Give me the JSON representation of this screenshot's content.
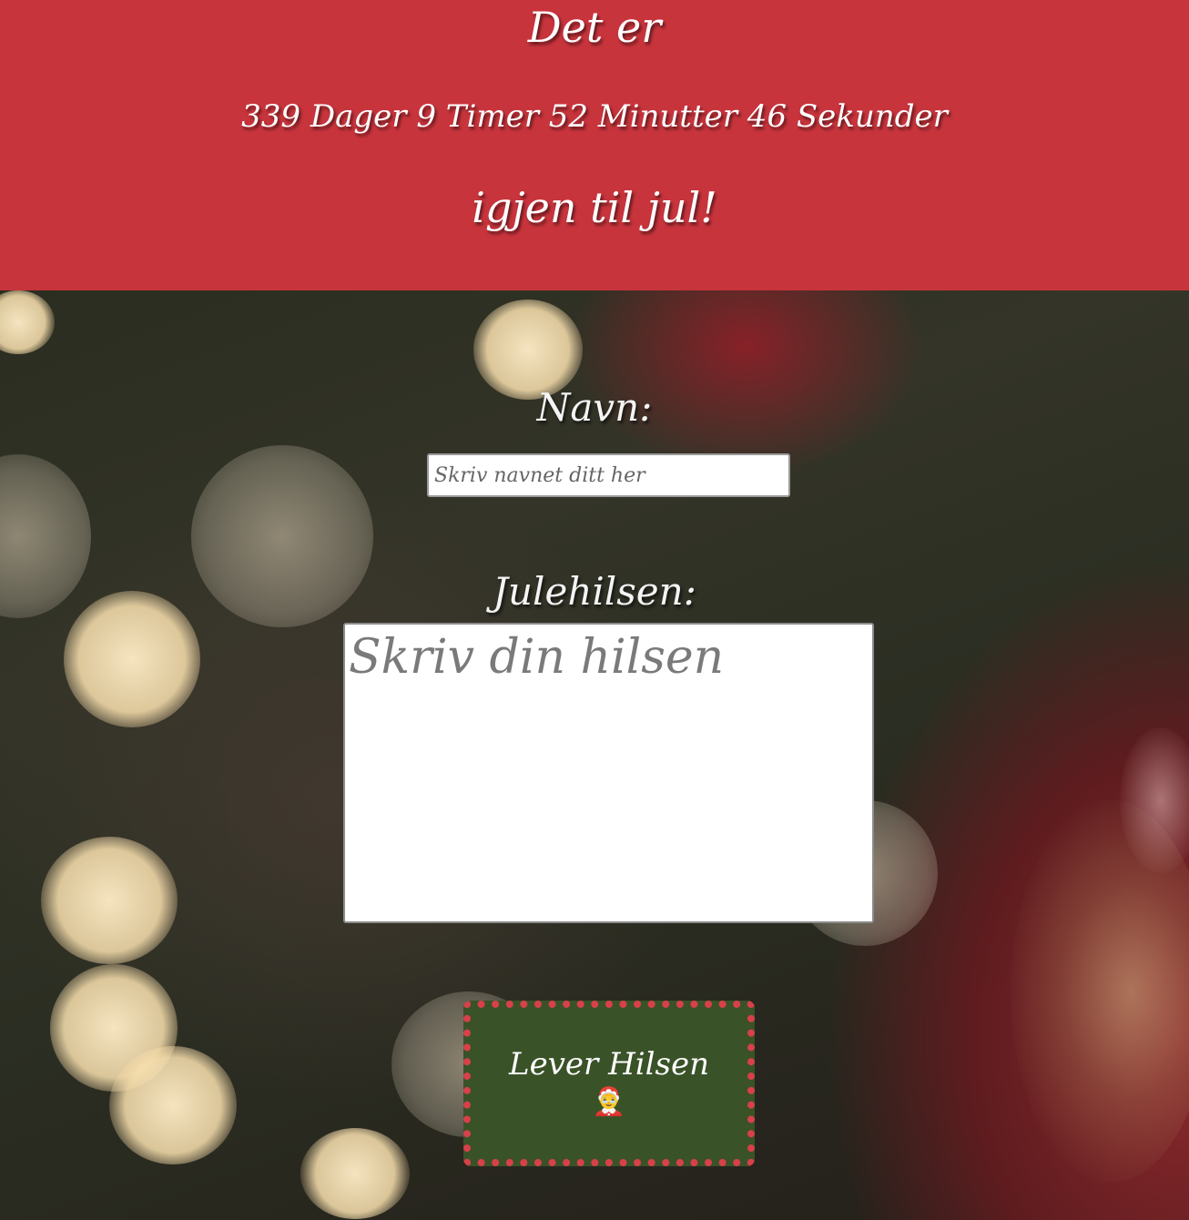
{
  "header": {
    "line1": "Det er",
    "countdown": "339 Dager 9 Timer 52 Minutter 46 Sekunder",
    "line3": "igjen til jul!"
  },
  "form": {
    "name_label": "Navn:",
    "name_placeholder": "Skriv navnet ditt her",
    "greeting_label": "Julehilsen:",
    "greeting_placeholder": "Skriv din hilsen",
    "submit_label": "Lever Hilsen",
    "submit_emoji": "🤶"
  },
  "colors": {
    "header_bg": "#c8343c",
    "button_bg": "#3a5228",
    "button_dots": "#d8404a"
  }
}
